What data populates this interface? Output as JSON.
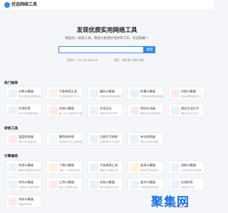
{
  "header": {
    "brand": "优选网络工具"
  },
  "hero": {
    "title": "发现优质实用网络工具",
    "subtitle": "精选对一优质工具，帮助大家更好地效率工作，欢迎收藏～",
    "search_placeholder": "",
    "search_button": "搜索",
    "ip_label": "您的IP：111.192.188.146",
    "location_label": "地区：湖北省十堰市 电信"
  },
  "sections": {
    "s1": {
      "title": "热门推荐"
    },
    "s2": {
      "title": "转换工具"
    },
    "s3": {
      "title": "计算器类"
    }
  },
  "cards": [
    {
      "title": "分数计算器",
      "desc": "支持分数加减乘除运算",
      "color": "#e8f1ff",
      "icon": "fraction-icon"
    },
    {
      "title": "平板电视工具",
      "desc": "在线检测电视尺寸大小",
      "color": "#fff0e0",
      "icon": "tv-icon"
    },
    {
      "title": "编码计算器",
      "desc": "快速转换常用编码格式",
      "color": "#e8f1ff",
      "icon": "code-icon"
    },
    {
      "title": "体重计算器",
      "desc": "计算标准体重健康指数",
      "color": "#e8f1ff",
      "icon": "scale-icon"
    },
    {
      "title": "年龄计算器",
      "desc": "精确计算年龄和生日",
      "color": "#ffe8ee",
      "icon": "calendar-icon"
    },
    {
      "title": "在线秒表",
      "desc": "在线计时精确到毫秒",
      "color": "#e8f1ff",
      "icon": "stopwatch-icon"
    },
    {
      "title": "年龄计算器",
      "desc": "输入出生日期即可计算",
      "color": "#ffe8ee",
      "icon": "calendar-icon"
    },
    {
      "title": "在线日历",
      "desc": "查看农历节日节气",
      "color": "#e8f1ff",
      "icon": "calendar-grid-icon"
    },
    {
      "title": "密码生成器",
      "desc": "随机生成高强度密码",
      "color": "#eeeeee",
      "icon": "lock-icon"
    },
    {
      "title": "随机生成文字",
      "desc": "随机生成中文汉字",
      "color": "#e8f1ff",
      "icon": "random-icon"
    },
    {
      "title": "温度转换器",
      "desc": "摄氏华氏温度互转",
      "color": "#ffe8ee",
      "icon": "thermometer-icon"
    },
    {
      "title": "繁简体转换",
      "desc": "简体繁体中文互相转换",
      "color": "#e8fff0",
      "icon": "text-icon"
    },
    {
      "title": "日期大写转换",
      "desc": "日期转换为大写格式",
      "color": "#e8f1ff",
      "icon": "date-icon"
    },
    {
      "title": "单位转换器",
      "desc": "常用计量单位换算",
      "color": "#e8f1ff",
      "icon": "convert-icon"
    },
    {
      "title": "房贷计算器",
      "desc": "等额本息等额本金计算",
      "color": "#e8f1ff",
      "icon": "house-icon"
    },
    {
      "title": "个税计算器",
      "desc": "最新个人所得税计算",
      "color": "#fff0e0",
      "icon": "tax-icon"
    },
    {
      "title": "平板电视工具",
      "desc": "屏幕尺寸换算计算",
      "color": "#e8f1ff",
      "icon": "tv-icon"
    },
    {
      "title": "身高计算器",
      "desc": "预测孩子未来身高",
      "color": "#fff4d6",
      "icon": "height-icon"
    },
    {
      "title": "油耗计算器",
      "desc": "计算汽车百公里油耗",
      "color": "#e8f1ff",
      "icon": "fuel-icon"
    },
    {
      "title": "时间计算器",
      "desc": "计算两个时间的间隔",
      "color": "#e8f1ff",
      "icon": "clock-icon"
    },
    {
      "title": "工资计算器",
      "desc": "税后工资快速计算",
      "color": "#ffe8ee",
      "icon": "wage-icon"
    },
    {
      "title": "存款计算器",
      "desc": "银行存款利息计算",
      "color": "#e8f1ff",
      "icon": "deposit-icon"
    },
    {
      "title": "复利计算器",
      "desc": "计算投资复利收益",
      "color": "#e8f1ff",
      "icon": "growth-icon"
    },
    {
      "title": "在线秒表",
      "desc": "精确计时工具",
      "color": "#e8f1ff",
      "icon": "stopwatch-icon"
    },
    {
      "title": "年龄计算器",
      "desc": "精确计算年龄",
      "color": "#ffe8ee",
      "icon": "calendar-icon"
    }
  ],
  "watermark": {
    "text": "聚集网",
    "sub": "www.jijiwang.com"
  }
}
